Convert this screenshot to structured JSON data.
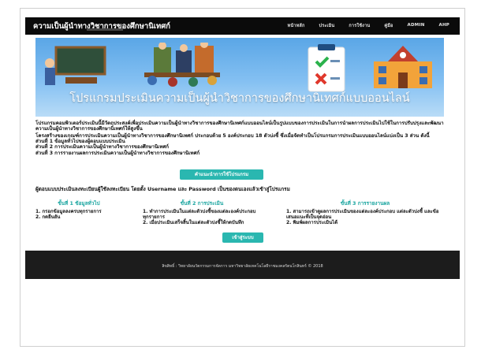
{
  "header": {
    "brand": "ความเป็นผู้นำทางวิชาการของศึกษานิเทศก์",
    "nav": [
      "หน้าหลัก",
      "ประเมิน",
      "การใช้งาน",
      "คู่มือ",
      "ADMIN",
      "AHP"
    ]
  },
  "banner": {
    "title": "โปรแกรมประเมินความเป็นผู้นำวิชาการของศึกษานิเทศก์แบบออนไลน์"
  },
  "intro": {
    "paragraph1": "โปรแกรมคอมพิวเตอร์ประเมินนี้มีวัตถุประสงค์เพื่อประเมินความเป็นผู้นำทางวิชาการของศึกษานิเทศก์แบบออนไลน์เป็นรูปแบบของการประเมินในการนำผลการประเมินไปใช้ในการปรับปรุงและพัฒนาความเป็นผู้นำทางวิชาการของศึกษานิเทศก์ให้สูงขึ้น",
    "paragraph2": "โครงสร้างของเกณฑ์การประเมินความเป็นผู้นำทางวิชาการของศึกษานิเทศก์ ประกอบด้วย 5 องค์ประกอบ 18 ตัวบ่งชี้ ซึ่งเมื่อจัดทำเป็นโปรแกรมการประเมินแบบออนไลน์แบ่งเป็น 3 ส่วน ดังนี้",
    "parts": [
      "ส่วนที่ 1 ข้อมูลทั่วไปของผู้ตอบแบบประเมิน",
      "ส่วนที่ 2 การประเมินความเป็นผู้นำทางวิชาการของศึกษานิเทศก์",
      "ส่วนที่ 3 การรายงานผลการประเมินความเป็นผู้นำทางวิชาการของศึกษานิเทศก์"
    ]
  },
  "guide_button": "คำแนะนำการใช้โปรแกรม",
  "login_text": "ผู้ตอบแบบประเมินลงทะเบียนผู้ใช้ลงทะเบียน โดยตั้ง Username และ Password เป็นของตนเองแล้วเข้าสู่โปรแกรม",
  "steps": [
    {
      "title": "ขั้นที่ 1 ข้อมูลทั่วไป",
      "items": [
        "1. กรอกข้อมูลลงครบทุกรายการ",
        "2. กดยืนยัน"
      ]
    },
    {
      "title": "ขั้นที่ 2 การประเมิน",
      "items": [
        "1. ทำการประเมินในแต่ละตัวบ่งชี้ของแต่ละองค์ประกอบทุกรายการ",
        "2. เมื่อประเมินเสร็จสิ้นในแต่ละตัวบ่งชี้ให้กดบันทึก"
      ]
    },
    {
      "title": "ขั้นที่ 3 การรายงานผล",
      "items": [
        "1. สามารถเข้าดูผลการประเมินของแต่ละองค์ประกอบ แต่ละตัวบ่งชี้ และข้อเสนอแนะที่เป็นจุดอ่อน",
        "2. พิมพ์ผลการประเมินได้"
      ]
    }
  ],
  "login_button": "เข้าสู่ระบบ",
  "footer": "ลิขสิทธิ์ : วิทยาลัยนวัตกรรมการจัดการ มหาวิทยาลัยเทคโนโลยีราชมงคลรัตนโกสินทร์ © 2018",
  "colors": {
    "accent": "#2ab7b0",
    "topbar": "#0b0b0b",
    "footer": "#1c1c1c",
    "banner": "#5aa6e6"
  }
}
